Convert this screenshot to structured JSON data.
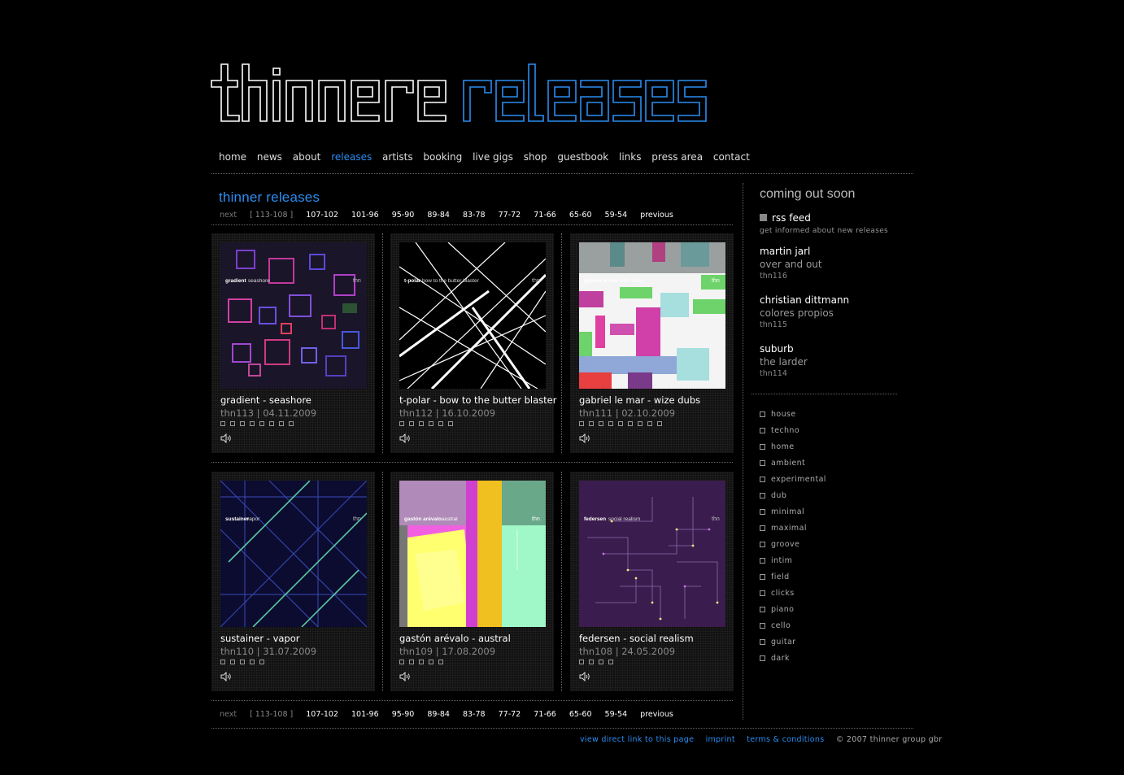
{
  "logo": {
    "word1": "thinner",
    "word2": "releases",
    "color1": "#ffffff",
    "color2": "#2a8df0"
  },
  "nav": [
    {
      "label": "home",
      "active": false
    },
    {
      "label": "news",
      "active": false
    },
    {
      "label": "about",
      "active": false
    },
    {
      "label": "releases",
      "active": true
    },
    {
      "label": "artists",
      "active": false
    },
    {
      "label": "booking",
      "active": false
    },
    {
      "label": "live gigs",
      "active": false
    },
    {
      "label": "shop",
      "active": false
    },
    {
      "label": "guestbook",
      "active": false
    },
    {
      "label": "links",
      "active": false
    },
    {
      "label": "press area",
      "active": false
    },
    {
      "label": "contact",
      "active": false
    }
  ],
  "section_title": "thinner releases",
  "pager": {
    "next": "next",
    "current": "[ 113-108 ]",
    "pages": [
      "107-102",
      "101-96",
      "95-90",
      "89-84",
      "83-78",
      "77-72",
      "71-66",
      "65-60",
      "59-54"
    ],
    "previous": "previous"
  },
  "releases": [
    {
      "title": "gradient - seashore",
      "info": "thn113 | 04.11.2009",
      "cover_artist": "gradient",
      "cover_title": "seashore",
      "genre_icons": 8,
      "audio_icon": "speaker-icon"
    },
    {
      "title": "t-polar - bow to the butter blaster",
      "info": "thn112 | 16.10.2009",
      "cover_artist": "t-polar",
      "cover_title": "bow to the butter blaster",
      "genre_icons": 6,
      "audio_icon": "speaker-icon"
    },
    {
      "title": "gabriel le mar - wize dubs",
      "info": "thn111 | 02.10.2009",
      "cover_artist": "gabriel le mar",
      "cover_title": "wize dubs",
      "genre_icons": 9,
      "audio_icon": "speaker-icon"
    },
    {
      "title": "sustainer - vapor",
      "info": "thn110 | 31.07.2009",
      "cover_artist": "sustainer",
      "cover_title": "vapor",
      "genre_icons": 5,
      "audio_icon": "speaker-icon"
    },
    {
      "title": "gastón arévalo - austral",
      "info": "thn109 | 17.08.2009",
      "cover_artist": "gastón arévalo",
      "cover_title": "austral",
      "genre_icons": 5,
      "audio_icon": "speaker-icon"
    },
    {
      "title": "federsen - social realism",
      "info": "thn108 | 24.05.2009",
      "cover_artist": "federsen",
      "cover_title": "social realism",
      "genre_icons": 4,
      "audio_icon": "speaker-icon"
    }
  ],
  "cover_mark": "thn",
  "sidebar": {
    "title": "coming out soon",
    "rss_label": "rss feed",
    "rss_sub": "get informed about new releases",
    "upcoming": [
      {
        "artist": "martin jarl",
        "title": "over and out",
        "cat": "thn116"
      },
      {
        "artist": "christian dittmann",
        "title": "colores propios",
        "cat": "thn115"
      },
      {
        "artist": "suburb",
        "title": "the larder",
        "cat": "thn114"
      }
    ],
    "genres": [
      "house",
      "techno",
      "home",
      "ambient",
      "experimental",
      "dub",
      "minimal",
      "maximal",
      "groove",
      "intim",
      "field",
      "clicks",
      "piano",
      "cello",
      "guitar",
      "dark"
    ]
  },
  "footer": {
    "links": [
      "view direct link to this page",
      "imprint",
      "terms & conditions"
    ],
    "copyright": "© 2007 thinner group gbr"
  }
}
